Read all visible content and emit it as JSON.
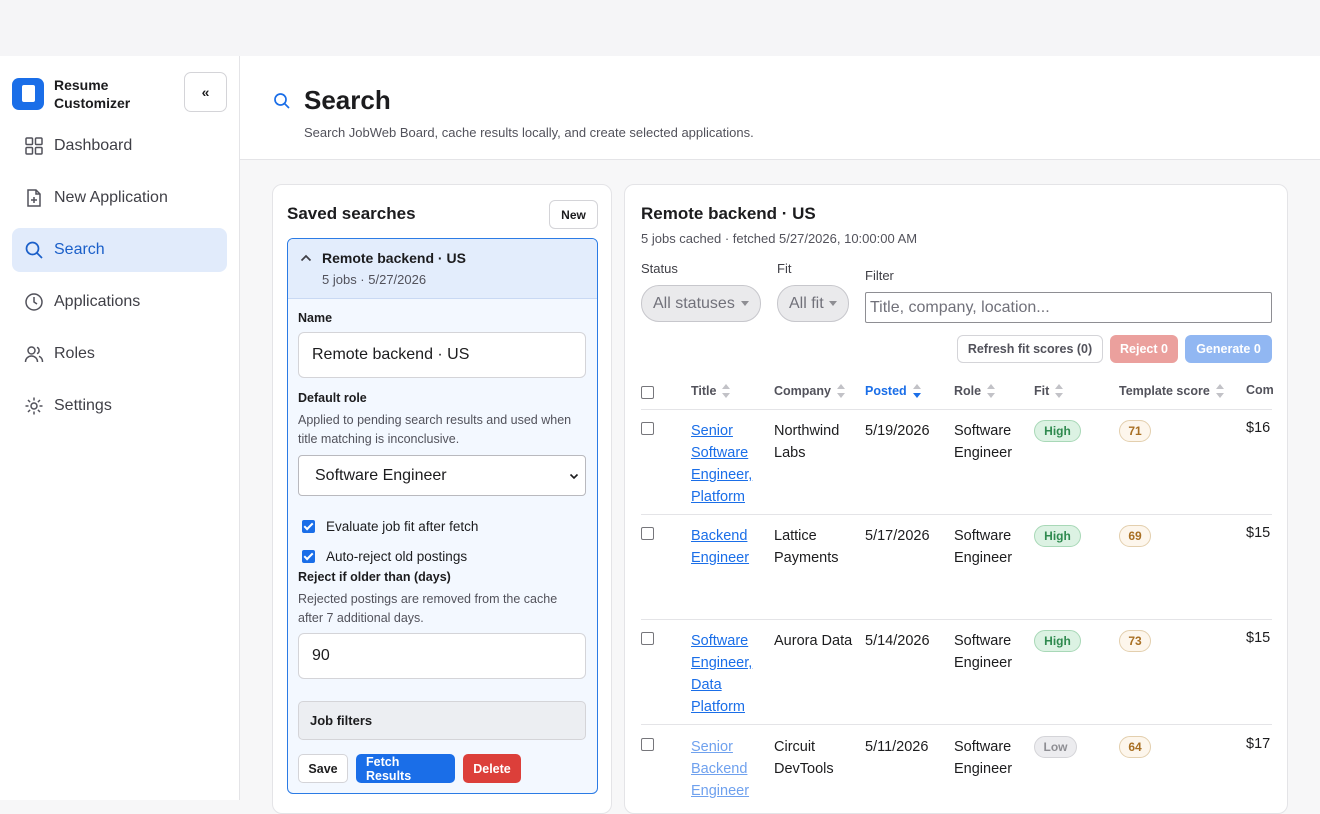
{
  "app": {
    "brand_line1": "Resume",
    "brand_line2": "Customizer",
    "collapse_label": "«"
  },
  "nav": [
    {
      "label": "Dashboard",
      "icon": "grid-icon"
    },
    {
      "label": "New Application",
      "icon": "file-plus-icon"
    },
    {
      "label": "Search",
      "icon": "search-icon",
      "active": true
    },
    {
      "label": "Applications",
      "icon": "clock-icon"
    },
    {
      "label": "Roles",
      "icon": "users-icon"
    },
    {
      "label": "Settings",
      "icon": "gear-icon"
    }
  ],
  "header": {
    "title": "Search",
    "subtitle": "Search JobWeb Board, cache results locally, and create selected applications."
  },
  "saved": {
    "title": "Saved searches",
    "new_label": "New",
    "card": {
      "name": "Remote backend · US",
      "meta": "5 jobs · 5/27/2026",
      "name_label": "Name",
      "name_value": "Remote backend · US",
      "role_label": "Default role",
      "role_help": "Applied to pending search results and used when title matching is inconclusive.",
      "role_value": "Software Engineer",
      "evaluate_label": "Evaluate job fit after fetch",
      "autoreject_label": "Auto-reject old postings",
      "reject_label": "Reject if older than (days)",
      "reject_help": "Rejected postings are removed from the cache after 7 additional days.",
      "reject_value": "90",
      "job_filters_label": "Job filters",
      "save_label": "Save",
      "fetch_label": "Fetch Results",
      "delete_label": "Delete"
    }
  },
  "results": {
    "title": "Remote backend · US",
    "meta": "5 jobs cached · fetched 5/27/2026, 10:00:00 AM",
    "status_label": "Status",
    "status_value": "All statuses",
    "fit_label": "Fit",
    "fit_value": "All fit",
    "filter_label": "Filter",
    "filter_placeholder": "Title, company, location...",
    "refresh_label": "Refresh fit scores (0)",
    "reject_label": "Reject 0",
    "generate_label": "Generate 0",
    "columns": [
      "Title",
      "Company",
      "Posted",
      "Role",
      "Fit",
      "Template score",
      "Com"
    ],
    "rows": [
      {
        "title": "Senior Software Engineer, Platform",
        "company": "Northwind Labs",
        "posted": "5/19/2026",
        "role": "Software Engineer",
        "fit": "High",
        "score": "71",
        "comp": "$16"
      },
      {
        "title": "Backend Engineer",
        "company": "Lattice Payments",
        "posted": "5/17/2026",
        "role": "Software Engineer",
        "fit": "High",
        "score": "69",
        "comp": "$15"
      },
      {
        "title": "Software Engineer, Data Platform",
        "company": "Aurora Data",
        "posted": "5/14/2026",
        "role": "Software Engineer",
        "fit": "High",
        "score": "73",
        "comp": "$15"
      },
      {
        "title": "Senior Backend Engineer",
        "company": "Circuit DevTools",
        "posted": "5/11/2026",
        "role": "Software Engineer",
        "fit": "Low",
        "score": "64",
        "comp": "$17"
      }
    ]
  },
  "colors": {
    "accent": "#1a6ee8",
    "danger": "#dc3f3a",
    "fit_high": "#2f8a4f",
    "score": "#a86f23"
  }
}
